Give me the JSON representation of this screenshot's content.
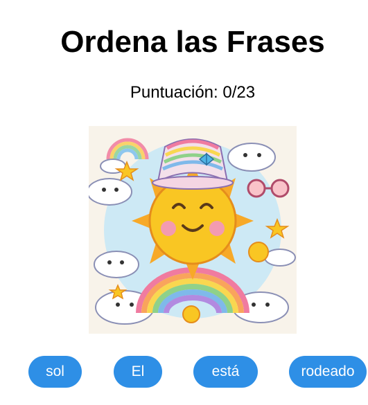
{
  "game": {
    "title": "Ordena las Frases",
    "score_label": "Puntuación: 0/23"
  },
  "illustration": {
    "subject": "cartoon smiling sun with rainbow hat, clouds, rainbows and stars",
    "icon": "sun-illustration-icon"
  },
  "words": [
    "sol",
    "El",
    "está",
    "rodeado"
  ],
  "colors": {
    "word_button_bg": "#2e8fe6",
    "word_button_text": "#ffffff",
    "sun": "#f9c623",
    "background": "#ffffff"
  }
}
